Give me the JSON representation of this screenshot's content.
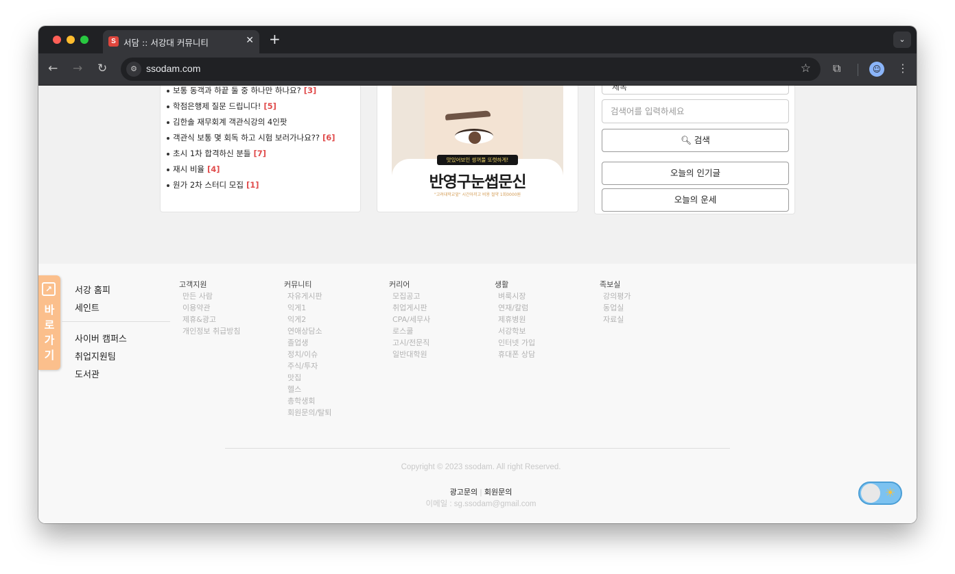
{
  "browser": {
    "tab_title": "서담 :: 서강대 커뮤니티",
    "favicon_letter": "S",
    "url": "ssodam.com"
  },
  "posts": [
    {
      "title": "보통 동객과 하끝 둘 중 하나만 하나요?",
      "count": "[3]"
    },
    {
      "title": "학점은행제 질문 드립니다!",
      "count": "[5]"
    },
    {
      "title": "김한솔 재무회계 객관식강의 4인팟",
      "count": ""
    },
    {
      "title": "객관식 보통 몇 회독 하고 시험 보러가나요??",
      "count": "[6]"
    },
    {
      "title": "초시 1차 합격하신 분들",
      "count": "[7]"
    },
    {
      "title": "재시 비율",
      "count": "[4]"
    },
    {
      "title": "원가 2차 스터디 모집",
      "count": "[1]"
    }
  ],
  "ad": {
    "tag": "맛있어보인 쌍꺼풀 또렷하게!",
    "title": "반영구눈썹문신",
    "subtitle": "\"고려대학교앞\" 시간아끼고 비용 절약 1회0000원"
  },
  "search": {
    "select_value": "제목",
    "placeholder": "검색어를 입력하세요",
    "search_label": "검색",
    "popular_label": "오늘의 인기글",
    "fortune_label": "오늘의 운세"
  },
  "shortcut": {
    "label": "바로가기",
    "links_top": [
      "서강 홈피",
      "세인트"
    ],
    "links_bottom": [
      "사이버 캠퍼스",
      "취업지원팀",
      "도서관"
    ]
  },
  "footer_columns": [
    {
      "title": "고객지원",
      "items": [
        "만든 사람",
        "이용약관",
        "제휴&광고",
        "개인정보 취급방침"
      ]
    },
    {
      "title": "커뮤니티",
      "items": [
        "자유게시판",
        "익게1",
        "익게2",
        "연애상담소",
        "졸업생",
        "정치/이슈",
        "주식/투자",
        "맛집",
        "헬스",
        "총학생회",
        "회원문의/탈퇴"
      ]
    },
    {
      "title": "커리어",
      "items": [
        "모집공고",
        "취업게시판",
        "CPA/세무사",
        "로스쿨",
        "고시/전문직",
        "일반대학원"
      ]
    },
    {
      "title": "생활",
      "items": [
        "벼룩시장",
        "연재/칼럼",
        "제휴병원",
        "서강학보",
        "인터넷 가입",
        "휴대폰 상담"
      ]
    },
    {
      "title": "족보실",
      "items": [
        "강의평가",
        "동업실",
        "자료실"
      ]
    }
  ],
  "footer": {
    "copyright": "Copyright © 2023 ssodam. All right Reserved.",
    "ad_inquiry": "광고문의",
    "member_inquiry": "회원문의",
    "email": "이메일 : sg.ssodam@gmail.com"
  }
}
